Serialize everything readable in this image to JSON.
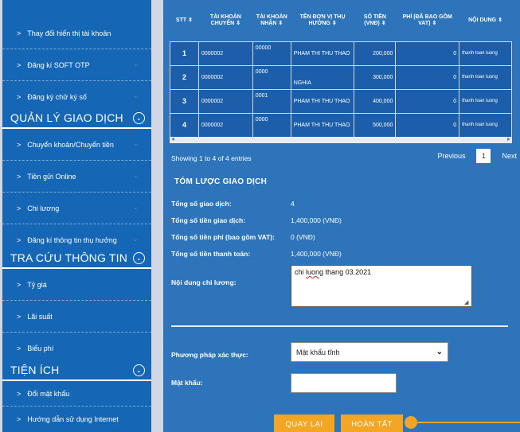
{
  "sidebar": {
    "top_items": [
      "Thay đổi hiển thị tài khoản",
      "Đăng kí SOFT OTP",
      "Đăng ký chữ ký số"
    ],
    "sections": [
      {
        "title": "QUẢN LÝ GIAO DỊCH",
        "items": [
          "Chuyển khoản/Chuyển tiền",
          "Tiền gửi Online",
          "Chi lương",
          "Đăng kí thông tin thụ hưởng"
        ]
      },
      {
        "title": "TRA CỨU THÔNG TIN",
        "items": [
          "Tỷ giá",
          "Lãi suất",
          "Biểu phí"
        ]
      },
      {
        "title": "TIỆN ÍCH",
        "items": [
          "Đổi mật khẩu",
          "Hướng dẫn sử dụng Internet"
        ]
      }
    ]
  },
  "table": {
    "headers": [
      "STT",
      "TÀI KHOẢN CHUYỂN",
      "TÀI KHOẢN NHẬN",
      "TÊN ĐƠN VỊ THỤ HƯỞNG",
      "SỐ TIỀN (VNĐ)",
      "PHÍ (ĐÃ BAO GỒM VAT)",
      "NỘI DUNG"
    ],
    "rows": [
      {
        "stt": "1",
        "from": "0000002",
        "to": "00000",
        "name": "PHAM THI THU THAO",
        "amount": "200,000",
        "fee": "0",
        "content": "thanh toan luong"
      },
      {
        "stt": "2",
        "from": "0000002",
        "to": "0000",
        "name": "NGHIA",
        "amount": "300,000",
        "fee": "0",
        "content": "thanh toan luong"
      },
      {
        "stt": "3",
        "from": "0000002",
        "to": "0001",
        "name": "PHAM THI THU THAO",
        "amount": "400,000",
        "fee": "0",
        "content": "thanh toan luong"
      },
      {
        "stt": "4",
        "from": "0000002",
        "to": "0000",
        "name": "PHAM THI THU THAO",
        "amount": "500,000",
        "fee": "0",
        "content": "thanh toan luong"
      }
    ]
  },
  "pagination": {
    "info": "Showing 1 to 4 of 4 entries",
    "previous": "Previous",
    "page": "1",
    "next": "Next"
  },
  "summary": {
    "title": "TÓM LƯỢC GIAO DỊCH",
    "rows": [
      {
        "label": "Tổng số giao dịch:",
        "value": "4"
      },
      {
        "label": "Tổng số tiền giao dịch:",
        "value": "1,400,000 (VNĐ)"
      },
      {
        "label": "Tổng số tiền phí (bao gồm VAT):",
        "value": "0 (VNĐ)"
      },
      {
        "label": "Tổng số tiền thanh toán:",
        "value": "1,400,000 (VNĐ)"
      }
    ]
  },
  "form": {
    "note_label": "Nội dung chi lương:",
    "note_value_a": "chi ",
    "note_value_b": "luong",
    "note_value_c": " thang 03.2021",
    "auth_label": "Phương pháp xác thực:",
    "auth_value": "Mật khẩu tĩnh",
    "password_label": "Mật khẩu:",
    "back_button": "QUAY LẠI",
    "done_button": "HOÀN TẤT"
  },
  "colors": {
    "primary": "#1566b4",
    "accent": "#f2a623",
    "panel": "#2d74bb"
  }
}
